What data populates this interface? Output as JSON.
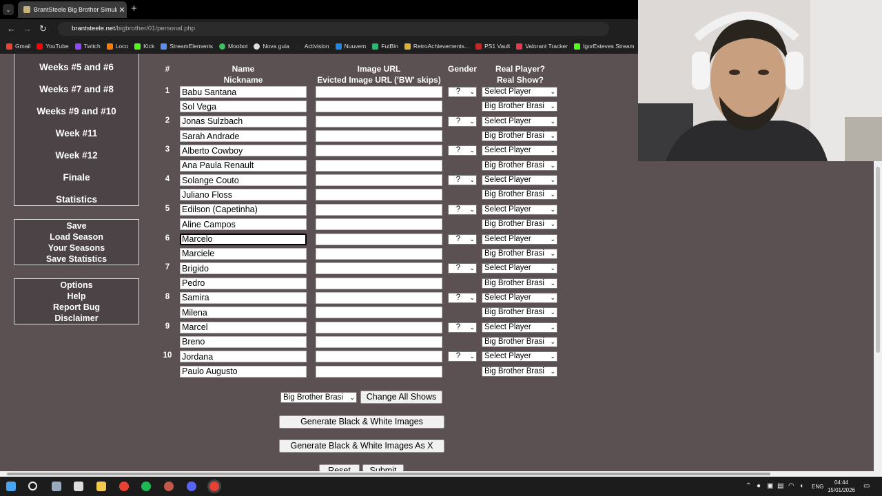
{
  "browser": {
    "tab_title": "BrantSteele Big Brother Simula",
    "url_domain": "brantsteele.net",
    "url_path": "/bigbrother/01/personal.php",
    "bookmarks": [
      "Gmail",
      "YouTube",
      "Twitch",
      "Loco",
      "Kick",
      "StreamElements",
      "Moobot",
      "Nova guia",
      "Activision",
      "Nuuvem",
      "FutBin",
      "RetroAchievements...",
      "PS1 Vault",
      "Valorant Tracker",
      "IgorEsteves Stream"
    ]
  },
  "sidebar": {
    "weeks": [
      "Weeks #5 and #6",
      "Weeks #7 and #8",
      "Weeks #9 and #10",
      "Week #11",
      "Week #12",
      "Finale",
      "Statistics"
    ],
    "season": [
      "Save",
      "Load Season",
      "Your Seasons",
      "Save Statistics"
    ],
    "misc": [
      "Options",
      "Help",
      "Report Bug",
      "Disclaimer"
    ]
  },
  "table": {
    "headers": {
      "num": "#",
      "name": "Name",
      "nickname": "Nickname",
      "image": "Image URL",
      "evicted": "Evicted Image URL ('BW' skips)",
      "gender": "Gender",
      "player": "Real Player?",
      "show": "Real Show?"
    },
    "gender_default": "?",
    "player_default": "Select Player",
    "show_default": "Big Brother Brasi",
    "rows": [
      {
        "num": "1",
        "name": "Babu Santana",
        "nickname": "Sol Vega"
      },
      {
        "num": "2",
        "name": "Jonas Sulzbach",
        "nickname": "Sarah Andrade"
      },
      {
        "num": "3",
        "name": "Alberto Cowboy",
        "nickname": "Ana Paula Renault"
      },
      {
        "num": "4",
        "name": "Solange Couto",
        "nickname": "Juliano Floss"
      },
      {
        "num": "5",
        "name": "Edilson (Capetinha)",
        "nickname": "Aline Campos"
      },
      {
        "num": "6",
        "name": "Marcelo",
        "nickname": "Marciele"
      },
      {
        "num": "7",
        "name": "Brigido",
        "nickname": "Pedro"
      },
      {
        "num": "8",
        "name": "Samira",
        "nickname": "Milena"
      },
      {
        "num": "9",
        "name": "Marcel",
        "nickname": "Breno"
      },
      {
        "num": "10",
        "name": "Jordana",
        "nickname": "Paulo Augusto"
      }
    ]
  },
  "actions": {
    "all_shows_value": "Big Brother Brasi",
    "change_all": "Change All Shows",
    "gen_bw": "Generate Black & White Images",
    "gen_bw_x": "Generate Black & White Images As X",
    "reset": "Reset",
    "submit": "Submit"
  },
  "taskbar": {
    "lang": "ENG",
    "time": "04:44",
    "date": "15/01/2026"
  }
}
